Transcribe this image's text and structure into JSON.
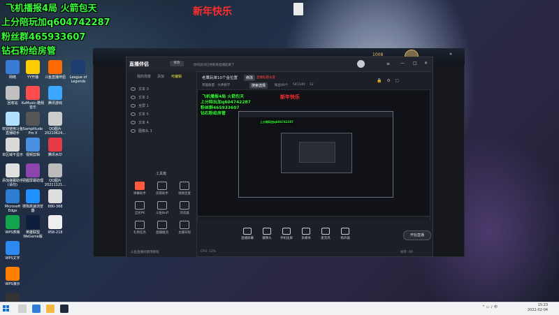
{
  "overlay": {
    "line1": "飞机播报4局   火箭包天",
    "line2": "上分陪玩加q604742287",
    "line3": "粉丝群465933607",
    "line4": "钻石粉给房管",
    "new_year": "新年快乐"
  },
  "desktop": {
    "recycle_caption": "网络",
    "icons": [
      {
        "label": "网络"
      },
      {
        "label": "YY开播"
      },
      {
        "label": "斗鱼直播伴侣"
      },
      {
        "label": "回收站"
      },
      {
        "label": "KuMusic-酷我音乐"
      },
      {
        "label": "腾讯游戏"
      },
      {
        "label": "League of Legends"
      },
      {
        "label": "欢迎使用斗鱼直播助手"
      },
      {
        "label": "本区域不显示"
      },
      {
        "label": "添加弹幕助手(请勿)"
      },
      {
        "label": "Microsoft Edge"
      },
      {
        "label": "Samplitude Pro X"
      },
      {
        "label": "QQ图片20210624..."
      },
      {
        "label": "WPS表格"
      },
      {
        "label": "视频剪辑"
      },
      {
        "label": "腾讯水印"
      },
      {
        "label": "WPS文字"
      },
      {
        "label": "把握屏幕助理"
      },
      {
        "label": "QQ图片20211121..."
      },
      {
        "label": "WPS演示"
      },
      {
        "label": "搜狗高速浏览器"
      },
      {
        "label": "680-368"
      },
      {
        "label": "腾讯QQ"
      },
      {
        "label": "英雄联盟WeGame版"
      },
      {
        "label": "958-218"
      }
    ]
  },
  "lol": {
    "coins": "1008",
    "level": "31"
  },
  "app": {
    "logo": "直播伴侣",
    "room_hint": "你的房间已经能够直播起来了",
    "title_text": "老鹰玩单10个金位置",
    "tag_button": "修改",
    "tag_red": "直播标题长度",
    "category": "英雄联盟 · 大神教学",
    "hot_button": "搜索选择",
    "fans_label": "粉丝40个",
    "online_label": "541140",
    "likes": "12",
    "tabs": [
      "我的场景",
      "添加",
      "可编辑"
    ],
    "sources": [
      "文本 3",
      "文本 2",
      "全屏 1",
      "文本 5",
      "文本 4",
      "图像头 1"
    ],
    "tools_header": "工具箱",
    "tools": [
      {
        "label": "弹幕助手"
      },
      {
        "label": "房管助手"
      },
      {
        "label": "视频连麦"
      },
      {
        "label": "全民PK"
      },
      {
        "label": "斗鱼Buff"
      },
      {
        "label": "浏览器"
      },
      {
        "label": "礼物任务"
      },
      {
        "label": "直播推流"
      },
      {
        "label": "主播日程"
      }
    ],
    "bottom_hint": "斗鱼直播间使用教程",
    "bottom_buttons": [
      {
        "label": "直播屏幕"
      },
      {
        "label": "摄像头"
      },
      {
        "label": "手机投屏"
      },
      {
        "label": "多媒体"
      },
      {
        "label": "麦克风"
      },
      {
        "label": "扬声器"
      }
    ],
    "start_button": "开始直播",
    "status_left": "CPU: 12%",
    "status_right": "帧率: 60"
  },
  "taskbar": {
    "time": "15:23",
    "date": "2022-02-04"
  },
  "colors": {
    "overlay_green": "#36ff3a",
    "overlay_red": "#ff2d2d",
    "accent_yellow": "#e8e54a",
    "tool_red": "#ff5a3c"
  }
}
